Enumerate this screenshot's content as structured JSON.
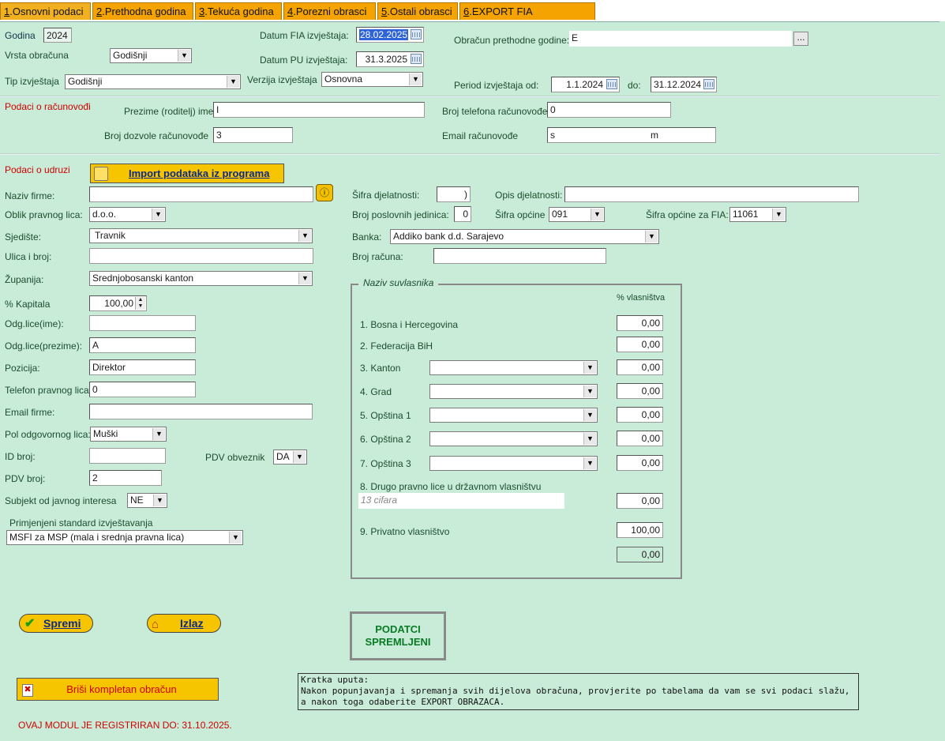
{
  "tabs": [
    {
      "key": "1",
      "label": ".Osnovni podaci",
      "active": true
    },
    {
      "key": "2",
      "label": ".Prethodna godina"
    },
    {
      "key": "3",
      "label": ".Tekuća godina"
    },
    {
      "key": "4",
      "label": ".Porezni obrasci"
    },
    {
      "key": "5",
      "label": ".Ostali obrasci"
    },
    {
      "key": "6",
      "label": ".EXPORT FIA OBRAZACA"
    }
  ],
  "header": {
    "godina_label": "Godina",
    "godina": "2024",
    "vrsta_label": "Vrsta obračuna",
    "vrsta": "Godišnji",
    "tip_label": "Tip izvještaja",
    "tip": "Godišnji",
    "datum_fia_label": "Datum FIA izvještaja:",
    "datum_fia": "28.02.2025",
    "datum_pu_label": "Datum PU izvještaja:",
    "datum_pu": "31.3.2025",
    "verzija_label": "Verzija izvještaja",
    "verzija": "Osnovna",
    "obracun_label": "Obračun prethodne godine:",
    "obracun": "E",
    "browse": "...",
    "period_label": "Period izvještaja od:",
    "period_od": "1.1.2024",
    "do_label": "do:",
    "period_do": "31.12.2024"
  },
  "racunovodja": {
    "section": "Podaci o računovođi",
    "prezime_label": "Prezime (roditelj) ime",
    "prezime": "I",
    "dozvola_label": "Broj dozvole računovođe",
    "dozvola": "3",
    "telefon_label": "Broj telefona računovođe",
    "telefon": "0",
    "email_label": "Email računovođe",
    "email": "s",
    "email_end": "m"
  },
  "udruga": {
    "section": "Podaci o udruzi",
    "import_btn": "Import podataka iz programa",
    "naziv_label": "Naziv firme:",
    "naziv": "",
    "oblik_label": "Oblik pravnog lica:",
    "oblik": "d.o.o.",
    "sjediste_label": "Sjedište:",
    "sjediste": "Travnik",
    "ulica_label": "Ulica i broj:",
    "ulica": "",
    "zupanija_label": "Županija:",
    "zupanija": "Srednjobosanski kanton",
    "kapital_label": "% Kapitala",
    "kapital": "100,00",
    "odg_ime_label": "Odg.lice(ime):",
    "odg_ime": "",
    "odg_prezime_label": "Odg.lice(prezime):",
    "odg_prezime": "A",
    "pozicija_label": "Pozicija:",
    "pozicija": "Direktor",
    "telefon_label": "Telefon pravnog lica:",
    "telefon": "0",
    "email_label": "Email firme:",
    "email": "",
    "pol_label": "Pol odgovornog lica:",
    "pol": "Muški",
    "id_label": "ID broj:",
    "id": "",
    "pdv_obveznik_label": "PDV obveznik",
    "pdv_obveznik": "DA",
    "pdv_broj_label": "PDV broj:",
    "pdv_broj": "2",
    "subjekt_label": "Subjekt od javnog interesa",
    "subjekt": "NE",
    "standard_label": "Primjenjeni standard izvještavanja",
    "standard": "MSFI za MSP (mala i srednja pravna lica)",
    "sifra_dj_label": "Šifra djelatnosti:",
    "sifra_dj": ")",
    "opis_dj_label": "Opis djelatnosti:",
    "opis_dj": "",
    "posl_jed_label": "Broj poslovnih jedinica:",
    "posl_jed": "0",
    "sifra_op_label": "Šifra općine",
    "sifra_op": "091",
    "sifra_op_fia_label": "Šifra općine za FIA:",
    "sifra_op_fia": "11061",
    "banka_label": "Banka:",
    "banka": "Addiko bank d.d. Sarajevo",
    "racun_label": "Broj računa:",
    "racun": ""
  },
  "suvlasnici": {
    "title": "Naziv suvlasnika",
    "pct_header": "% vlasništva",
    "rows": [
      {
        "label": "1. Bosna i Hercegovina",
        "value": "0,00"
      },
      {
        "label": "2. Federacija BiH",
        "value": "0,00"
      },
      {
        "label": "3. Kanton",
        "value": "0,00"
      },
      {
        "label": "4. Grad",
        "value": "0,00"
      },
      {
        "label": "5. Opština 1",
        "value": "0,00"
      },
      {
        "label": "6. Opština 2",
        "value": "0,00"
      },
      {
        "label": "7. Opština 3",
        "value": "0,00"
      }
    ],
    "drugo_label": "8. Drugo pravno lice u državnom vlasništvu",
    "drugo_placeholder": "13 cifara",
    "drugo_value": "0,00",
    "privatno_label": "9. Privatno vlasništvo",
    "privatno_value": "100,00",
    "total": "0,00"
  },
  "actions": {
    "spremi": "Spremi",
    "izlaz": "Izlaz",
    "status": "PODATCI SPREMLJENI",
    "brisi": "Briši kompletan obračun",
    "uputa": "Kratka uputa:\nNakon popunjavanja i spremanja svih dijelova obračuna, provjerite po tabelama da vam se svi podaci slažu, a nakon toga odaberite EXPORT OBRAZACA.",
    "registered": "OVAJ MODUL JE REGISTRIRAN DO: 31.10.2025."
  },
  "colors": {
    "background": "#c8ecd8",
    "tab": "#f4a300",
    "button": "#f7c400",
    "warning": "#d00000"
  }
}
